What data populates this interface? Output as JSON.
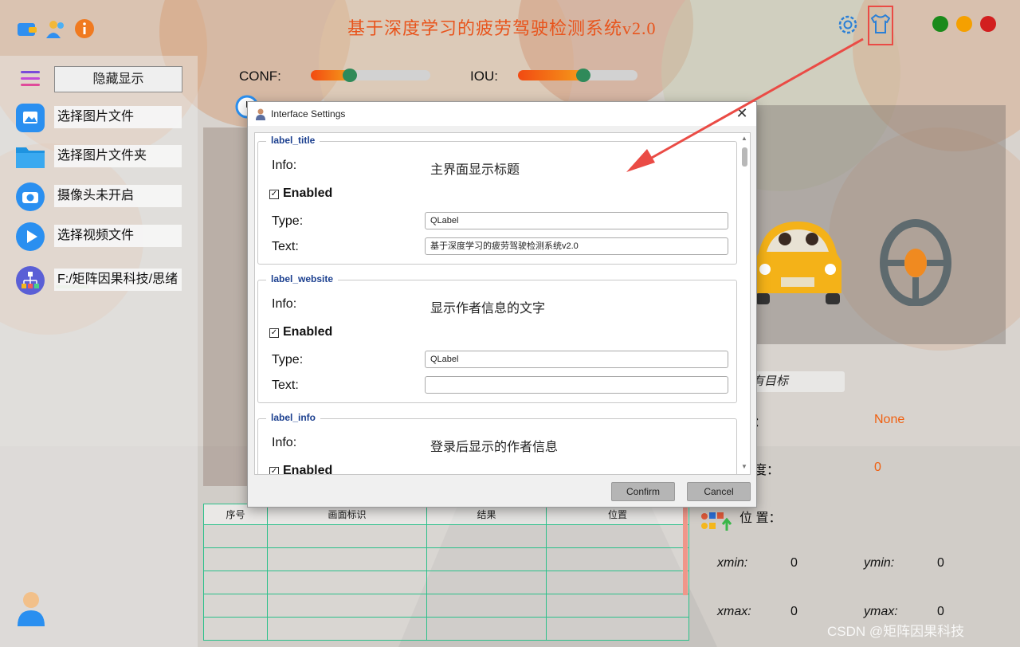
{
  "app": {
    "title": "基于深度学习的疲劳驾驶检测系统v2.0",
    "window_controls": {
      "close_color": "#1a8a1a",
      "min_color": "#f5a000",
      "max_color": "#d21f1f"
    }
  },
  "sidebar": {
    "hide_button": "隐藏显示",
    "items": [
      {
        "label": "选择图片文件",
        "icon": "image-icon"
      },
      {
        "label": "选择图片文件夹",
        "icon": "folder-icon"
      },
      {
        "label": "摄像头未开启",
        "icon": "camera-icon"
      },
      {
        "label": "选择视频文件",
        "icon": "play-icon"
      },
      {
        "label": "F:/矩阵因果科技/思绪",
        "icon": "network-icon"
      }
    ]
  },
  "sliders": {
    "conf_label": "CONF:",
    "conf_value": 0.3,
    "iou_label": "IOU:",
    "iou_value": 0.55
  },
  "results_table": {
    "headers": [
      "序号",
      "画面标识",
      "结果",
      "位置"
    ],
    "rows": [
      [
        "",
        "",
        "",
        ""
      ],
      [
        "",
        "",
        "",
        ""
      ],
      [
        "",
        "",
        "",
        ""
      ],
      [
        "",
        "",
        "",
        ""
      ],
      [
        "",
        "",
        "",
        ""
      ]
    ]
  },
  "right_panel": {
    "target_combo": "有目标",
    "class_label": "别：",
    "class_value": "None",
    "confidence_label": "信度：",
    "confidence_value": "0",
    "position_label": "位 置：",
    "xmin_label": "xmin:",
    "xmin_value": "0",
    "ymin_label": "ymin:",
    "ymin_value": "0",
    "xmax_label": "xmax:",
    "xmax_value": "0",
    "ymax_label": "ymax:",
    "ymax_value": "0"
  },
  "dialog": {
    "title": "Interface Settings",
    "groups": [
      {
        "name": "label_title",
        "info_label": "Info:",
        "info": "主界面显示标题",
        "enabled_label": "Enabled",
        "type_label": "Type:",
        "type": "QLabel",
        "text_label": "Text:",
        "text": "基于深度学习的疲劳驾驶检测系统v2.0"
      },
      {
        "name": "label_website",
        "info_label": "Info:",
        "info": "显示作者信息的文字",
        "enabled_label": "Enabled",
        "type_label": "Type:",
        "type": "QLabel",
        "text_label": "Text:",
        "text": ""
      },
      {
        "name": "label_info",
        "info_label": "Info:",
        "info": "登录后显示的作者信息",
        "enabled_label": "Enabled"
      }
    ],
    "confirm": "Confirm",
    "cancel": "Cancel"
  },
  "watermark": "CSDN @矩阵因果科技"
}
